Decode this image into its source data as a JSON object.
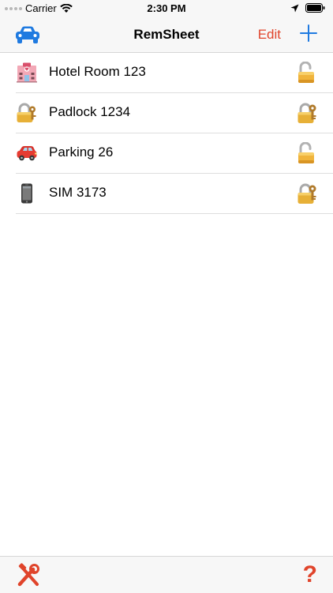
{
  "status_bar": {
    "carrier": "Carrier",
    "time": "2:30 PM"
  },
  "nav": {
    "title": "RemSheet",
    "edit_label": "Edit",
    "add_icon": "plus-icon",
    "left_icon": "car-icon"
  },
  "items": [
    {
      "label": "Hotel Room 123",
      "icon": "hotel-icon",
      "lock": "lock-open-icon"
    },
    {
      "label": "Padlock 1234",
      "icon": "padlock-icon",
      "lock": "lock-with-key-icon"
    },
    {
      "label": "Parking 26",
      "icon": "red-car-icon",
      "lock": "lock-open-icon"
    },
    {
      "label": "SIM 3173",
      "icon": "phone-icon",
      "lock": "lock-with-key-icon"
    }
  ],
  "toolbar": {
    "tools_icon": "tools-icon",
    "help_label": "?"
  },
  "colors": {
    "accent_red": "#e0442b",
    "accent_blue": "#1f7ae0"
  }
}
